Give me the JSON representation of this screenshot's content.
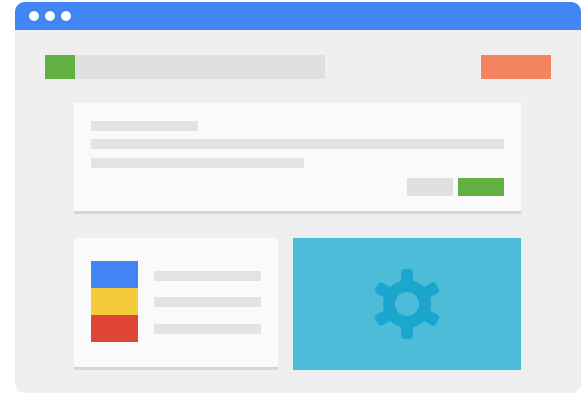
{
  "window": {
    "titlebar_color": "#4285f4",
    "background": "#efefef"
  },
  "toolbar": {
    "logo_color": "#62b044",
    "action_color": "#f4845f"
  },
  "content_card": {
    "secondary_button_color": "#e0e0e0",
    "primary_button_color": "#62b044"
  },
  "list_card": {
    "swatches": [
      "#4285f4",
      "#f4cb3a",
      "#df4638"
    ]
  },
  "settings_panel": {
    "color": "#4dbcd9",
    "icon": "gear-icon",
    "icon_color": "#1ba6cf"
  }
}
